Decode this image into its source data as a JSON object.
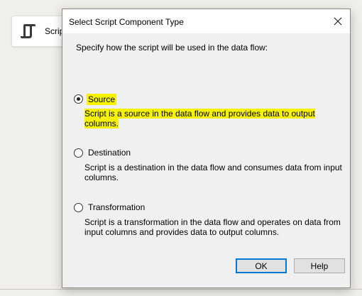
{
  "component": {
    "label": "Script"
  },
  "dialog": {
    "title": "Select Script Component Type",
    "instruction": "Specify how the script will be used in the data flow:",
    "options": [
      {
        "label": "Source",
        "description": "Script is a source in the data flow and provides data to output columns.",
        "selected": true,
        "highlighted": true
      },
      {
        "label": "Destination",
        "description": "Script is a destination in the data flow and consumes data from input columns.",
        "selected": false
      },
      {
        "label": "Transformation",
        "description": "Script is a transformation in the data flow and operates on data from input columns and provides data to output columns.",
        "selected": false
      }
    ],
    "buttons": {
      "ok": "OK",
      "help": "Help"
    }
  },
  "colors": {
    "highlight": "#f7f300",
    "default_button_border": "#0078d7",
    "dialog_bg": "#f0f0f0"
  }
}
